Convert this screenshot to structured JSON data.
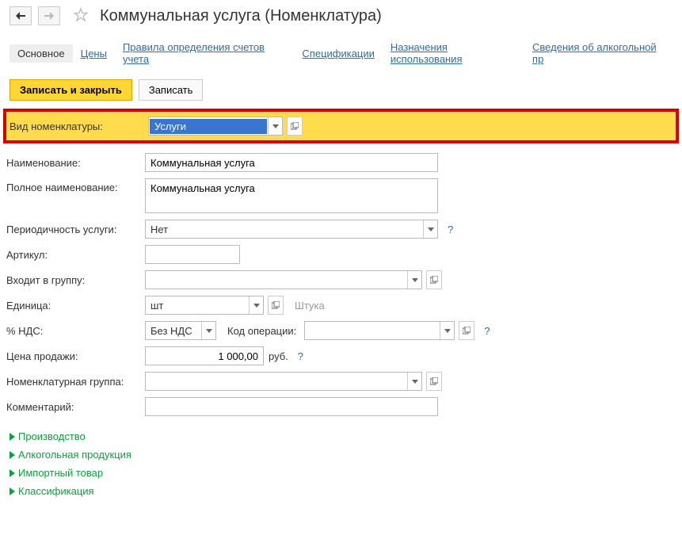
{
  "header": {
    "title": "Коммунальная услуга (Номенклатура)"
  },
  "tabs": [
    {
      "label": "Основное",
      "active": true
    },
    {
      "label": "Цены"
    },
    {
      "label": "Правила определения счетов учета"
    },
    {
      "label": "Спецификации"
    },
    {
      "label": "Назначения использования"
    },
    {
      "label": "Сведения об алкогольной пр"
    }
  ],
  "toolbar": {
    "save_close": "Записать и закрыть",
    "save": "Записать"
  },
  "form": {
    "type_label": "Вид номенклатуры:",
    "type_value": "Услуги",
    "name_label": "Наименование:",
    "name_value": "Коммунальная услуга",
    "fullname_label": "Полное наименование:",
    "fullname_value": "Коммунальная услуга",
    "period_label": "Периодичность услуги:",
    "period_value": "Нет",
    "article_label": "Артикул:",
    "article_value": "",
    "group_label": "Входит в группу:",
    "group_value": "",
    "unit_label": "Единица:",
    "unit_value": "шт",
    "unit_hint": "Штука",
    "vat_label": "% НДС:",
    "vat_value": "Без НДС",
    "opcode_label": "Код операции:",
    "opcode_value": "",
    "price_label": "Цена продажи:",
    "price_value": "1 000,00",
    "price_currency": "руб.",
    "nomgroup_label": "Номенклатурная группа:",
    "nomgroup_value": "",
    "comment_label": "Комментарий:",
    "comment_value": ""
  },
  "expanders": [
    {
      "label": "Производство"
    },
    {
      "label": "Алкогольная продукция"
    },
    {
      "label": "Импортный товар"
    },
    {
      "label": "Классификация"
    }
  ]
}
